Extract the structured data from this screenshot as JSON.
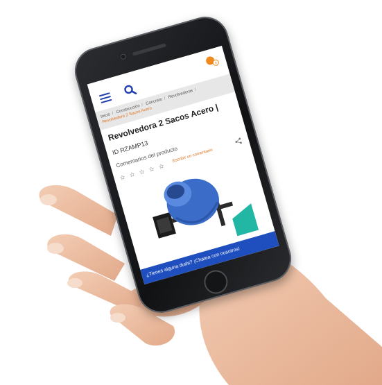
{
  "header": {
    "menu_icon": "hamburger-menu-icon",
    "search_icon": "search-icon",
    "cart_icon": "cart-icon",
    "cart_count": "0"
  },
  "breadcrumb": {
    "items": [
      "Inicio",
      "Construcción",
      "Concreto",
      "Revolvedoras"
    ],
    "current": "Revolvedora 2 Sacos Acero"
  },
  "product": {
    "title": "Revolvedora 2 Sacos Acero |",
    "id_label": "ID RZAMP13",
    "comments_label": "Comentarios del producto",
    "stars": "☆ ☆ ☆ ☆ ☆",
    "write_review": "Escribir un comentario",
    "share_icon": "share-icon",
    "image_icon": "concrete-mixer-image"
  },
  "chat": {
    "label": "¿Tienes alguna duda? ¡Chatea con nosotros!"
  },
  "colors": {
    "brand_blue": "#1f3fae",
    "accent_orange": "#e0731e",
    "chat_blue": "#1f4fbf"
  }
}
